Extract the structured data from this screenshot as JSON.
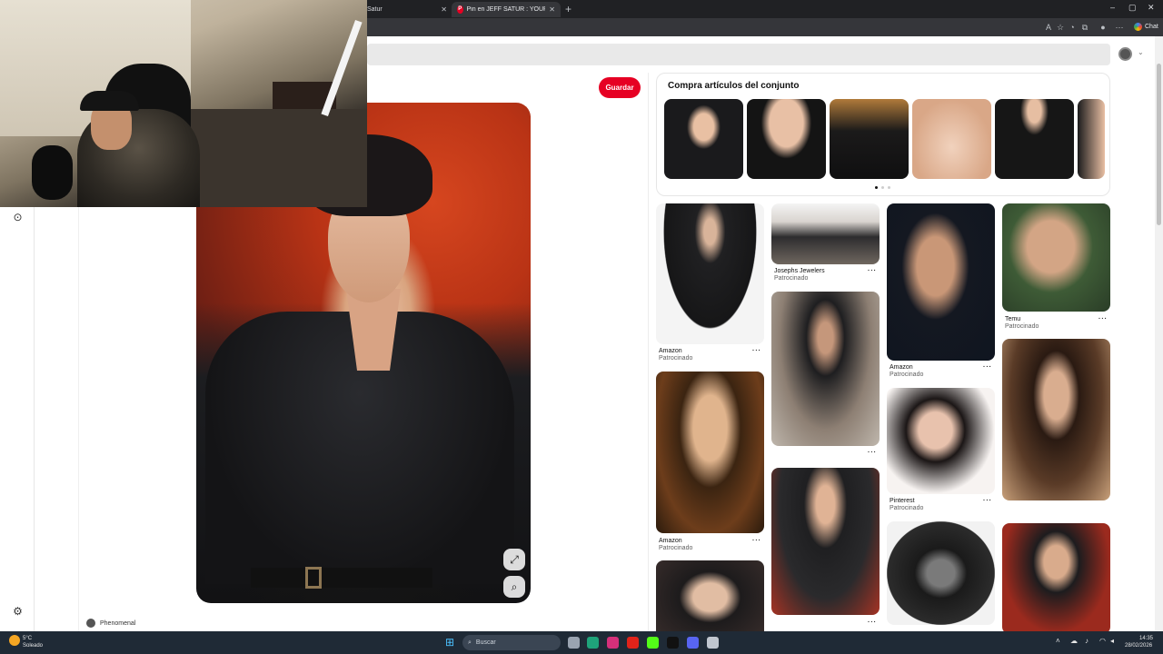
{
  "browser": {
    "tabs": [
      {
        "label": "Satur",
        "active": false
      },
      {
        "label": "Pin en JEFF SATUR : YOUR SATURN",
        "active": true
      }
    ],
    "new_tab_glyph": "+",
    "window_controls": [
      "–",
      "▢",
      "✕"
    ],
    "chat_label": "Chat"
  },
  "pin": {
    "save_label": "Guardar",
    "author": "Phenomenal"
  },
  "shop": {
    "title": "Compra artículos del conjunto",
    "item_count": 6,
    "active_dot": 0
  },
  "feed": {
    "col1": [
      {
        "source": "Amazon",
        "sub": "Patrocinado"
      },
      {
        "source": "Amazon",
        "sub": "Patrocinado"
      }
    ],
    "col2": [
      {
        "source": "Josephs Jewelers",
        "sub": "Patrocinado"
      }
    ],
    "col3": [
      {
        "source": "Amazon",
        "sub": "Patrocinado"
      },
      {
        "source": "Pinterest",
        "sub": "Patrocinado"
      }
    ],
    "col4": [
      {
        "source": "Temu",
        "sub": "Patrocinado"
      }
    ],
    "more_glyph": "···"
  },
  "taskbar": {
    "weather_temp": "5°C",
    "weather_desc": "Soleado",
    "search_label": "Buscar",
    "time": "14:35",
    "date": "28/02/2026"
  },
  "colors": {
    "accent": "#e60023",
    "taskbar": "#1f2a36"
  }
}
